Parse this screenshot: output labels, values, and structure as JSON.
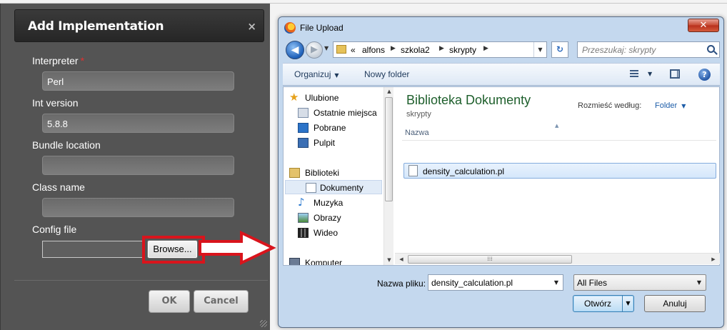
{
  "impl_dialog": {
    "title": "Add Implementation",
    "close_glyph": "×",
    "fields": [
      {
        "label": "Interpreter",
        "required_mark": "*",
        "value": "Perl"
      },
      {
        "label": "Int version",
        "value": "5.8.8"
      },
      {
        "label": "Bundle location",
        "value": ""
      },
      {
        "label": "Class name",
        "value": ""
      }
    ],
    "config_label": "Config file",
    "browse_label": "Browse...",
    "ok_label": "OK",
    "cancel_label": "Cancel"
  },
  "file_upload": {
    "title": "File Upload",
    "close_glyph": "✕",
    "nav": {
      "back_glyph": "◀",
      "fwd_glyph": "▶",
      "address": [
        "«",
        "alfons",
        "szkola2",
        "skrypty"
      ],
      "refresh_glyph": "↻",
      "search_placeholder": "Przeszukaj: skrypty"
    },
    "toolbar": {
      "organize": "Organizuj",
      "new_folder": "Nowy folder",
      "help_glyph": "?"
    },
    "nav_pane": {
      "favorites": "Ulubione",
      "recent": "Ostatnie miejsca",
      "downloads": "Pobrane",
      "desktop": "Pulpit",
      "libraries": "Biblioteki",
      "documents": "Dokumenty",
      "music": "Muzyka",
      "pictures": "Obrazy",
      "videos": "Wideo",
      "computer": "Komputer"
    },
    "content": {
      "library_title": "Biblioteka Dokumenty",
      "library_sub": "skrypty",
      "arrange_label": "Rozmieść według:",
      "arrange_value": "Folder",
      "column_name": "Nazwa",
      "file": "density_calculation.pl"
    },
    "bottom": {
      "filename_label": "Nazwa pliku:",
      "filename_value": "density_calculation.pl",
      "filetype_value": "All Files",
      "open_label": "Otwórz",
      "cancel_label": "Anuluj"
    }
  },
  "colors": {
    "highlight_red": "#d9141c",
    "dialog_bg": "#545454",
    "windows_frame": "#c4d8ee"
  }
}
